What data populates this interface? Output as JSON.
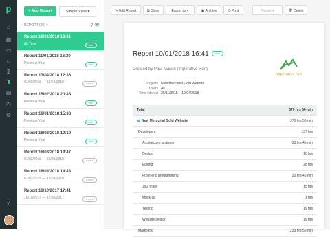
{
  "nav": {
    "logo": "p",
    "icons": [
      "home-icon",
      "grid-icon",
      "folder-icon",
      "user-icon",
      "dollar-icon",
      "reports-icon",
      "calendar-icon",
      "clock-icon",
      "settings-icon",
      "help-icon"
    ]
  },
  "sidebar": {
    "add_label": "+ Add Report",
    "view_label": "Simple View ▾",
    "reports_header": "REPORT (25) ▾",
    "reports": [
      {
        "title": "Report 10/01/2018 16:41",
        "sub": "All Time",
        "pill": "new",
        "selected": true
      },
      {
        "title": "Report 11/01/2018 16:30",
        "sub": "Previous Year",
        "pill": "new"
      },
      {
        "title": "Report 13/04/2018 12:36",
        "sub": "01/03/2018 — 16/04/2018",
        "pill": "expire"
      },
      {
        "title": "Report 15/02/2018 20:45",
        "sub": "Previous Year",
        "pill": "new"
      },
      {
        "title": "Report 16/01/2018 15:38",
        "sub": "Previous Year",
        "pill": "new"
      },
      {
        "title": "Report 16/02/2018 19:10",
        "sub": "Previous Year",
        "pill": "new"
      },
      {
        "title": "Report 16/03/2018 14:47",
        "sub": "01/02/2018 — 31/03/2018",
        "pill": "expire"
      },
      {
        "title": "Report 16/03/2018 14:48",
        "sub": "01/03/2018 — 16/03/2018",
        "pill": "expire"
      },
      {
        "title": "Report 16/10/2017 17:41",
        "sub": "16/10/2017 — 17/10/2017",
        "pill": "expire"
      }
    ]
  },
  "toolbar": {
    "edit": "✎ Edit Report",
    "clone": "⧉ Clone",
    "export": "Export as ▾",
    "archive": "▣ Archive",
    "print": "⎙ Print",
    "private": "Private ▾",
    "delete": "🗑 Delete"
  },
  "report": {
    "title": "Report 10/01/2018 16:41",
    "pill": "new",
    "created": "Created by Paul Mason (Imperative Run)",
    "brand_word": "imperative run",
    "meta": [
      {
        "k": "Projects",
        "v": "New Mercurial Gold Website"
      },
      {
        "k": "Users",
        "v": "All"
      },
      {
        "k": "Time interval",
        "v": "26/11/2015 – 19/04/2018"
      }
    ],
    "rows": [
      {
        "label": "Total",
        "value": "370 hrs 56 min",
        "kind": "hdr"
      },
      {
        "label": "New Mercurial Gold Website",
        "value": "370 hrs 56 min",
        "kind": "proj"
      },
      {
        "label": "Developers",
        "value": "137 hrs",
        "kind": "indent1"
      },
      {
        "label": "Architecture analysis",
        "value": "23 hrs 45 min",
        "kind": "indent2"
      },
      {
        "label": "Design",
        "value": "10 hrs",
        "kind": "indent2"
      },
      {
        "label": "Editing",
        "value": "28 hrs",
        "kind": "indent2"
      },
      {
        "label": "Front-end programming",
        "value": "20 hrs 46 min",
        "kind": "indent2"
      },
      {
        "label": "Jola mare",
        "value": "15 hrs",
        "kind": "indent2"
      },
      {
        "label": "Mock-up",
        "value": "1 hrs",
        "kind": "indent2"
      },
      {
        "label": "Testing",
        "value": "19 hrs",
        "kind": "indent2"
      },
      {
        "label": "Website Design",
        "value": "19 hrs",
        "kind": "indent2"
      },
      {
        "label": "Marketing",
        "value": "233 hrs 56 min",
        "kind": "indent1"
      }
    ]
  },
  "colors": {
    "accent": "#2ecc8f",
    "rail": "#253035"
  }
}
